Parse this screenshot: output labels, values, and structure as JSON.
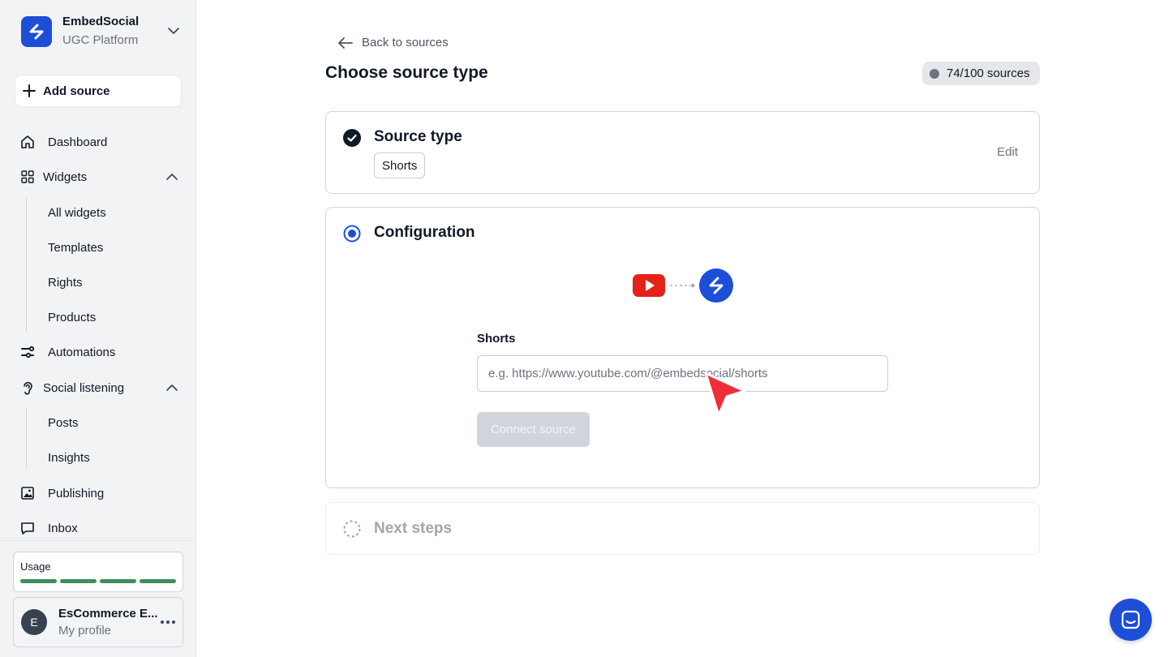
{
  "brand": {
    "name": "EmbedSocial",
    "subtitle": "UGC Platform"
  },
  "sidebar": {
    "add_source_label": "Add source",
    "nav": {
      "dashboard": "Dashboard",
      "widgets": "Widgets",
      "widgets_sub": [
        "All widgets",
        "Templates",
        "Rights",
        "Products"
      ],
      "automations": "Automations",
      "social_listening": "Social listening",
      "social_sub": [
        "Posts",
        "Insights"
      ],
      "publishing": "Publishing",
      "inbox": "Inbox"
    },
    "usage": {
      "label": "Usage",
      "segments_filled": 4,
      "segments_total": 4,
      "color": "#3e8e5e"
    },
    "profile": {
      "initial": "E",
      "name": "EsCommerce E...",
      "subtitle": "My profile"
    }
  },
  "main": {
    "back_label": "Back to sources",
    "title": "Choose source type",
    "quota": "74/100 sources",
    "steps": {
      "source_type": {
        "title": "Source type",
        "value": "Shorts",
        "edit_label": "Edit",
        "state": "complete"
      },
      "configuration": {
        "title": "Configuration",
        "state": "active",
        "field_label": "Shorts",
        "field_placeholder": "e.g. https://www.youtube.com/@embedsocial/shorts",
        "field_value": "",
        "connect_label": "Connect source",
        "connect_disabled": true
      },
      "next_steps": {
        "title": "Next steps",
        "state": "pending"
      }
    }
  },
  "colors": {
    "accent": "#1d4ed8",
    "youtube": "#e62117",
    "cursor": "#ef2d3a"
  }
}
